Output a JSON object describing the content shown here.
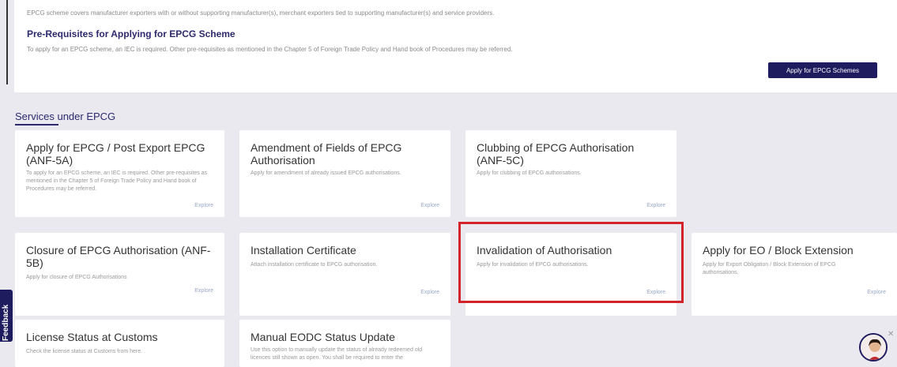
{
  "intro": {
    "text": "EPCG scheme covers manufacturer exporters with or without supporting manufacturer(s), merchant exporters tied to supporting manufacturer(s) and service providers.",
    "prereq_title": "Pre-Requisites for Applying for EPCG Scheme",
    "prereq_text": "To apply for an EPCG scheme, an IEC is required. Other pre-requisites as mentioned in the Chapter 5 of Foreign Trade Policy and Hand book of Procedures may be referred.",
    "apply_button": "Apply for EPCG Schemes"
  },
  "services": {
    "section_title": "Services under EPCG",
    "explore_label": "Explore",
    "cards": [
      {
        "title": "Apply for EPCG / Post Export EPCG (ANF-5A)",
        "desc": "To apply for an EPCG scheme, an IEC is required. Other pre-requisites as mentioned in the Chapter 5 of Foreign Trade Policy and Hand book of Procedures may be referred."
      },
      {
        "title": "Amendment of Fields of EPCG Authorisation",
        "desc": "Apply for amendment of already issued EPCG authorisations."
      },
      {
        "title": "Clubbing of EPCG Authorisation (ANF-5C)",
        "desc": "Apply for clubbing of EPCG authorisations."
      },
      {
        "title": "Closure of EPCG Authorisation (ANF-5B)",
        "desc": "Apply for closure of EPCG Authorisations"
      },
      {
        "title": "Installation Certificate",
        "desc": "Attach installation certificate to EPCG authorisation."
      },
      {
        "title": "Invalidation of Authorisation",
        "desc": "Apply for invalidation of EPCG authorisations."
      },
      {
        "title": "Apply for EO / Block Extension",
        "desc": "Apply for Export Obligation / Block Extension of EPCG authorisations."
      },
      {
        "title": "License Status at Customs",
        "desc": "Check the license status at Customs from here."
      },
      {
        "title": "Manual EODC Status Update",
        "desc": "Use this option to manually update the status of already redeemed old licences still shown as open. You shall be required to enter the"
      }
    ]
  },
  "feedback": {
    "label": "Feedback"
  },
  "colors": {
    "primary": "#1e1b5e",
    "highlight": "#d2232a",
    "background": "#e9e9ef"
  }
}
